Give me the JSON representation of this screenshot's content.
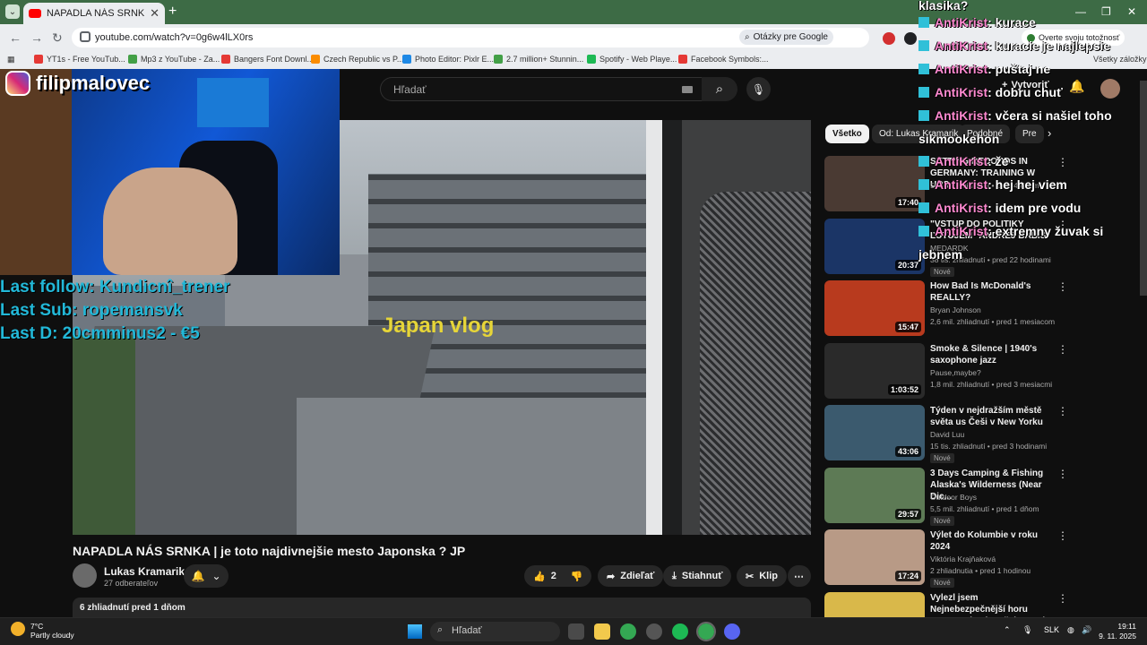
{
  "browser": {
    "tab_title": "NAPADLA NÁS SRNKA | je toto",
    "url": "youtube.com/watch?v=0g6w4lLX0rs",
    "lens_label": "Otázky pre Google",
    "verify_label": "Overte svoju totožnosť",
    "all_bookmarks_label": "Všetky záložky",
    "bookmarks": [
      {
        "label": "YT1s - Free YouTub...",
        "color": "#e53935"
      },
      {
        "label": "Mp3 z YouTube - Za...",
        "color": "#43a047"
      },
      {
        "label": "Bangers Font Downl...",
        "color": "#e53935"
      },
      {
        "label": "Czech Republic vs P...",
        "color": "#fb8c00"
      },
      {
        "label": "Photo Editor: Pixlr E...",
        "color": "#1e88e5"
      },
      {
        "label": "2.7 million+ Stunnin...",
        "color": "#43a047"
      },
      {
        "label": "Spotify - Web Playe...",
        "color": "#1db954"
      },
      {
        "label": "Facebook Symbols:...",
        "color": "#e53935"
      }
    ]
  },
  "youtube": {
    "search_placeholder": "Hľadať",
    "create_label": "Vytvoriť",
    "video_title": "NAPADLA NÁS SRNKA | je toto najdivnejšie mesto Japonska ? JP",
    "overlay_text": "Japan vlog",
    "channel_name": "Lukas Kramarik",
    "channel_subs": "27 odberateľov",
    "likes": "2",
    "share_label": "Zdieľať",
    "download_label": "Stiahnuť",
    "clip_label": "Klip",
    "views_line": "6 zhliadnutí  pred 1 dňom",
    "chips": [
      "Všetko",
      "Od: Lukas Kramarik",
      "Podobné",
      "Pre"
    ],
    "recommendations": [
      {
        "title": "SETTING RECORDS IN GERMANY: TRAINING W URS",
        "channel": "",
        "meta": "530 tis. zhliadnutí • pred 4 dňami",
        "duration": "17:40",
        "badge": "",
        "thumb": "#4a3a33"
      },
      {
        "title": "\"VSTUP DO POLITIKY ĽUTUJEM\" ANDREJ BABIŠ",
        "channel": "MEDARDK",
        "meta": "38 tis. zhliadnutí • pred 22 hodinami",
        "duration": "20:37",
        "badge": "Nové",
        "thumb": "#1b3566"
      },
      {
        "title": "How Bad Is McDonald's REALLY?",
        "channel": "Bryan Johnson",
        "meta": "2,6 mil. zhliadnutí • pred 1 mesiacom",
        "duration": "15:47",
        "badge": "",
        "thumb": "#b83a1e"
      },
      {
        "title": "Smoke & Silence  |  1940's saxophone jazz",
        "channel": "Pause,maybe?",
        "meta": "1,8 mil. zhliadnutí • pred 3 mesiacmi",
        "duration": "1:03:52",
        "badge": "",
        "thumb": "#2a2a2a"
      },
      {
        "title": "Týden v nejdražším městě světa us Češi v New Yorku",
        "channel": "David Luu",
        "meta": "15 tis. zhliadnutí • pred 3 hodinami",
        "duration": "43:06",
        "badge": "Nové",
        "thumb": "#3b5a6e"
      },
      {
        "title": "3 Days Camping & Fishing Alaska's Wilderness (Near Dic...",
        "channel": "Outdoor Boys",
        "meta": "5,5 mil. zhliadnutí • pred 1 dňom",
        "duration": "29:57",
        "badge": "Nové",
        "thumb": "#5d7a55"
      },
      {
        "title": "Výlet do Kolumbie v roku 2024",
        "channel": "Viktória Krajňaková",
        "meta": "2 zhliadnutia • pred 1 hodinou",
        "duration": "17:24",
        "badge": "Nové",
        "thumb": "#b89a86"
      },
      {
        "title": "Vylezl jsem Nejnebezpečnější horu Evropy, abych našel Smysl",
        "channel": "",
        "meta": "",
        "duration": "",
        "badge": "",
        "thumb": "#d9b84a"
      }
    ]
  },
  "stream": {
    "instagram": "filipmalovec",
    "last_follow": "Last follow: Kundicnî_trener",
    "last_sub": "Last Sub: ropemansvk",
    "last_donation": "Last D: 20cmminus2 - €5",
    "chat_header": "klasika?",
    "chat": [
      {
        "user": "AntiKrist",
        "msg": ": kurace"
      },
      {
        "user": "AntiKrist",
        "msg": ": kuracie je najlepsie"
      },
      {
        "user": "AntiKrist",
        "msg": ": puštaj ne"
      },
      {
        "user": "AntiKrist",
        "msg": ": dobru chuť"
      },
      {
        "user": "AntiKrist",
        "msg": ": včera si našiel toho sikmookehon"
      },
      {
        "user": "AntiKrist",
        "msg": ": že"
      },
      {
        "user": "AntiKrist",
        "msg": ": hej hej viem"
      },
      {
        "user": "AntiKrist",
        "msg": ": idem pre vodu"
      },
      {
        "user": "AntiKrist",
        "msg": ": extremny žuvak si jebnem"
      }
    ]
  },
  "taskbar": {
    "temp": "7°C",
    "weather": "Partly cloudy",
    "search_label": "Hľadať",
    "lang": "SLK",
    "time": "19:11",
    "date": "9. 11. 2025"
  }
}
